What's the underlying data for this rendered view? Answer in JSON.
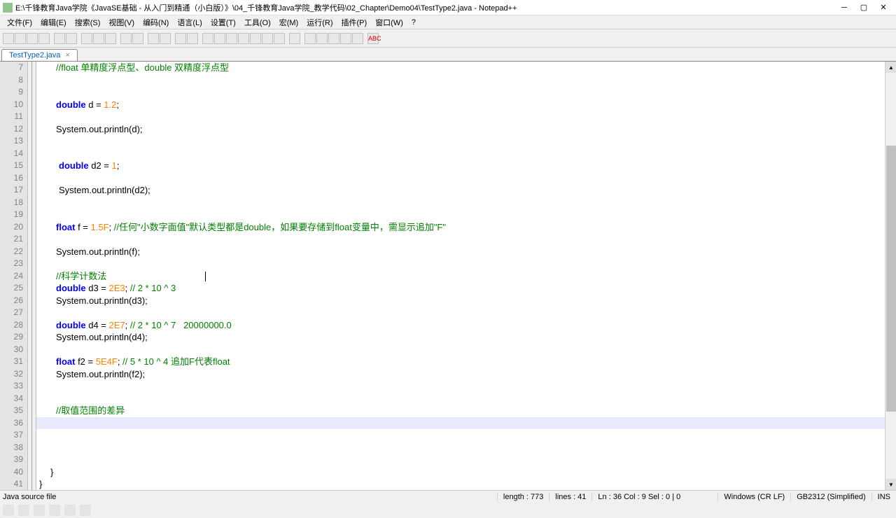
{
  "window": {
    "title": "E:\\千锋教育Java学院《JavaSE基础 - 从入门到精通（小白版）》\\04_千锋教育Java学院_教学代码\\02_Chapter\\Demo04\\TestType2.java - Notepad++"
  },
  "menu": {
    "items": [
      "文件(F)",
      "编辑(E)",
      "搜索(S)",
      "视图(V)",
      "编码(N)",
      "语言(L)",
      "设置(T)",
      "工具(O)",
      "宏(M)",
      "运行(R)",
      "插件(P)",
      "窗口(W)",
      "?"
    ]
  },
  "tab": {
    "label": "TestType2.java"
  },
  "code_lines": [
    {
      "n": 7,
      "cls": "",
      "html": "<span class='comment'>//float 单精度浮点型、double 双精度浮点型</span>"
    },
    {
      "n": 8,
      "cls": "",
      "html": ""
    },
    {
      "n": 9,
      "cls": "",
      "html": ""
    },
    {
      "n": 10,
      "cls": "",
      "html": "<span class='kw'>double</span> d = <span class='num'>1.2</span>;"
    },
    {
      "n": 11,
      "cls": "",
      "html": ""
    },
    {
      "n": 12,
      "cls": "",
      "html": "System.out.println(d);"
    },
    {
      "n": 13,
      "cls": "",
      "html": ""
    },
    {
      "n": 14,
      "cls": "",
      "html": ""
    },
    {
      "n": 15,
      "cls": "indent2",
      "html": "<span class='kw'>double</span> d2 = <span class='num'>1</span>;"
    },
    {
      "n": 16,
      "cls": "",
      "html": ""
    },
    {
      "n": 17,
      "cls": "indent2",
      "html": "System.out.println(d2);"
    },
    {
      "n": 18,
      "cls": "",
      "html": ""
    },
    {
      "n": 19,
      "cls": "",
      "html": ""
    },
    {
      "n": 20,
      "cls": "",
      "html": "<span class='kw'>float</span> f = <span class='num'>1.5F</span>; <span class='comment'>//任何\"小数字面值\"默认类型都是double，如果要存储到float变量中，需显示追加\"F\"</span>"
    },
    {
      "n": 21,
      "cls": "",
      "html": ""
    },
    {
      "n": 22,
      "cls": "",
      "html": "System.out.println(f);"
    },
    {
      "n": 23,
      "cls": "",
      "html": ""
    },
    {
      "n": 24,
      "cls": "",
      "html": "<span class='comment'>//科学计数法</span>                                       <span class='cursor-mark'></span>"
    },
    {
      "n": 25,
      "cls": "",
      "html": "<span class='kw'>double</span> d3 = <span class='num'>2E3</span>; <span class='comment'>// 2 * 10 ^ 3</span>"
    },
    {
      "n": 26,
      "cls": "",
      "html": "System.out.println(d3);"
    },
    {
      "n": 27,
      "cls": "",
      "html": ""
    },
    {
      "n": 28,
      "cls": "",
      "html": "<span class='kw'>double</span> d4 = <span class='num'>2E7</span>; <span class='comment'>// 2 * 10 ^ 7   20000000.0</span>"
    },
    {
      "n": 29,
      "cls": "",
      "html": "System.out.println(d4);"
    },
    {
      "n": 30,
      "cls": "",
      "html": ""
    },
    {
      "n": 31,
      "cls": "",
      "html": "<span class='kw'>float</span> f2 = <span class='num'>5E4F</span>; <span class='comment'>// 5 * 10 ^ 4 追加F代表float</span>"
    },
    {
      "n": 32,
      "cls": "",
      "html": "System.out.println(f2);"
    },
    {
      "n": 33,
      "cls": "",
      "html": ""
    },
    {
      "n": 34,
      "cls": "",
      "html": ""
    },
    {
      "n": 35,
      "cls": "",
      "html": "<span class='comment'>//取值范围的差异</span>"
    },
    {
      "n": 36,
      "cls": "highlight",
      "html": ""
    },
    {
      "n": 37,
      "cls": "",
      "html": ""
    },
    {
      "n": 38,
      "cls": "",
      "html": ""
    },
    {
      "n": 39,
      "cls": "",
      "html": ""
    },
    {
      "n": 40,
      "cls": "",
      "html0": "}",
      "pad": 16
    },
    {
      "n": 41,
      "cls": "",
      "html0": "}",
      "pad": 0
    }
  ],
  "status": {
    "filetype": "Java source file",
    "length": "length : 773",
    "lines": "lines : 41",
    "pos": "Ln : 36    Col : 9    Sel : 0 | 0",
    "eol": "Windows (CR LF)",
    "enc": "GB2312 (Simplified)",
    "mode": "INS"
  }
}
